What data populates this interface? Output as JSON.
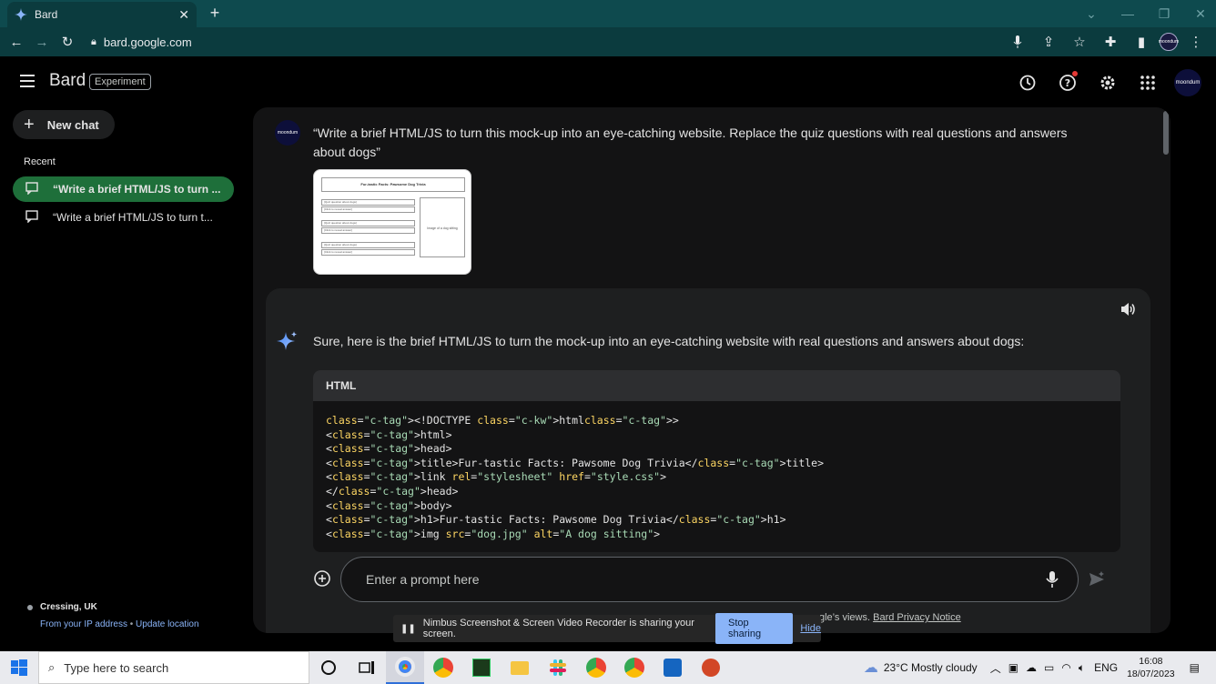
{
  "browser": {
    "tab_title": "Bard",
    "url": "bard.google.com"
  },
  "header": {
    "brand": "Bard",
    "badge": "Experiment"
  },
  "sidebar": {
    "new_chat": "New chat",
    "recent_label": "Recent",
    "items": [
      {
        "label": "“Write a brief HTML/JS to turn ..."
      },
      {
        "label": "“Write a brief HTML/JS to turn t..."
      }
    ],
    "location": "Cressing, UK",
    "location_source": "From your IP address",
    "location_separator": "•",
    "update_location": "Update location"
  },
  "conversation": {
    "user_prompt": "“Write a brief HTML/JS to turn this mock-up into an eye-catching website. Replace the quiz questions with real questions and answers about dogs”",
    "user_avatar_text": "moondum",
    "mockup": {
      "title": "Fur-tastic Facts: Pawsome Dog Trivia",
      "question": "[Quiz question about dogs]",
      "answer": "[Click to reveal answer]",
      "image_label": "Image of a dog sitting"
    },
    "response_text": "Sure, here is the brief HTML/JS to turn the mock-up into an eye-catching website with real questions and answers about dogs:",
    "code_language": "HTML",
    "code_lines": [
      "<!DOCTYPE html>",
      "<html>",
      "<head>",
      "<title>Fur-tastic Facts: Pawsome Dog Trivia</title>",
      "<link rel=\"stylesheet\" href=\"style.css\">",
      "</head>",
      "<body>",
      "<h1>Fur-tastic Facts: Pawsome Dog Trivia</h1>",
      "<img src=\"dog.jpg\" alt=\"A dog sitting\">"
    ]
  },
  "input": {
    "placeholder": "Enter a prompt here"
  },
  "footer": {
    "note": "gle’s views.",
    "privacy_link": "Bard Privacy Notice"
  },
  "share_banner": {
    "message": "Nimbus Screenshot & Screen Video Recorder is sharing your screen.",
    "stop_label": "Stop sharing",
    "hide_label": "Hide"
  },
  "taskbar": {
    "search_placeholder": "Type here to search",
    "weather": "23°C  Mostly cloudy",
    "language": "ENG",
    "time": "16:08",
    "date": "18/07/2023"
  },
  "colors": {
    "tab_bar": "#0e4a4e",
    "active_recent": "#1e6f3a",
    "accent_link": "#8ab4f8"
  }
}
